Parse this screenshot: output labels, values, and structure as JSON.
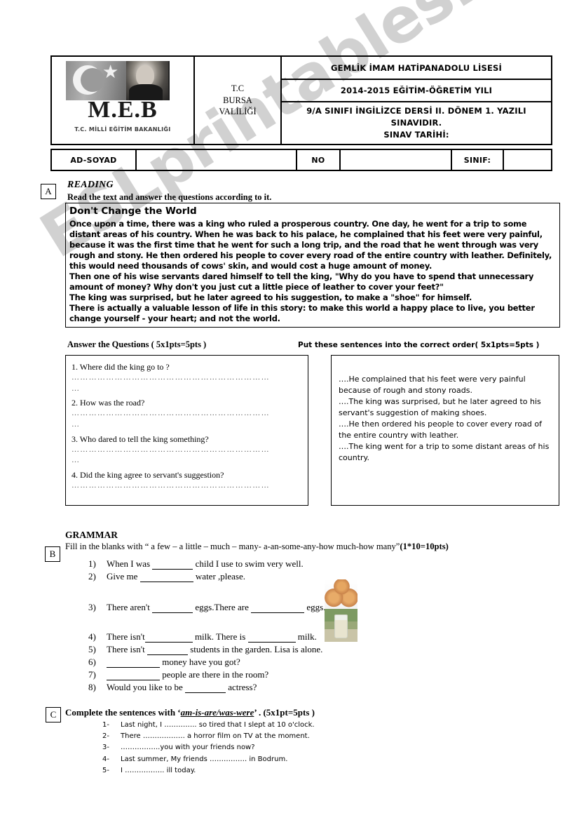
{
  "header": {
    "logo": {
      "meb_text": "M.E.B",
      "meb_subtitle": "T.C. MİLLİ EĞİTİM BAKANLIĞI"
    },
    "tc_cell": "T.C\nBURSA\nVALİLİĞİ",
    "tc_line1": "T.C",
    "tc_line2": "BURSA",
    "tc_line3": "VALİLİĞİ",
    "school": "GEMLİK İMAM HATİPANADOLU LİSESİ",
    "year": "2014-2015 EĞİTİM-ÖĞRETİM YILI",
    "exam_line1": "9/A SINIFI İNGİLİZCE DERSİ II. DÖNEM 1. YAZILI SINAVIDIR.",
    "exam_line2": "SINAV TARİHİ:"
  },
  "student_row": {
    "name_label": "AD-SOYAD",
    "name_value": "",
    "no_label": "NO",
    "no_value": "",
    "class_label": "SINIF:",
    "class_value": ""
  },
  "sections": {
    "a_letter": "A",
    "b_letter": "B",
    "c_letter": "C"
  },
  "reading": {
    "title": "READING",
    "instruction": "Read the text and answer the questions according to it.",
    "passage_title": "Don't Change the World",
    "passage_paragraphs": [
      "Once upon a time, there was a king who ruled a prosperous country. One day, he went for a trip to some distant areas of his country. When he was back to his palace, he complained that his feet were very painful, because it was the first time that he went for such a long trip, and the road that he went through was very rough and stony. He then ordered his people to cover every road of the entire country with leather. Definitely, this would need thousands of cows' skin, and would cost a huge amount of money.",
      "Then one of his wise servants dared himself to tell the king, \"Why do you have to spend that unnecessary amount of money? Why don't you just cut a little piece of leather to cover your feet?\"",
      "The king was surprised, but he later agreed to his suggestion, to make a \"shoe\" for himself.",
      "There is actually a valuable lesson of life in this story: to make this world a happy place to live, you better change yourself - your heart; and not the world."
    ]
  },
  "questions": {
    "heading": "Answer the Questions ( 5x1pts=5pts )",
    "dots_line": "……………………………………………………………",
    "dots_short": "…",
    "items": [
      "1. Where did the king go to ?",
      "2. How was the road?",
      "3. Who dared to tell the king something?",
      "4. Did the king agree to servant's suggestion?"
    ]
  },
  "ordering": {
    "heading": "Put these sentences into the correct order( 5x1pts=5pts )",
    "items": [
      "….He complained that his feet were very painful because of rough and stony roads.",
      "….The king was surprised, but he later agreed to his servant's suggestion of making shoes.",
      "….He then ordered his people to cover every road of the entire country with leather.",
      "….The king went for a trip to some distant areas of his country."
    ]
  },
  "grammar": {
    "title": "GRAMMAR",
    "instruction_plain": "Fill in the blanks with “ a few – a little – much – many- a-an-some-any-how much-how many”",
    "instruction_points": "(1*10=10pts)",
    "items": [
      {
        "num": "1)",
        "pre": "When I was",
        "blank": "b60",
        "post": "child I use to swim very well."
      },
      {
        "num": "2)",
        "pre": "Give me",
        "blank": "b78",
        "post": "water ,please."
      },
      {
        "num": "3)",
        "pre": "There aren't",
        "blank": "b60",
        "mid": "eggs.There are",
        "blank2": "b78",
        "post": "eggs."
      },
      {
        "num": "4)",
        "pre": "There isn't",
        "blank": "b70",
        "mid": "milk. There is",
        "blank2": "b70",
        "post": "milk."
      },
      {
        "num": "5)",
        "pre": "There isn't",
        "blank": "b60",
        "post": "students in the garden. Lisa is alone."
      },
      {
        "num": "6)",
        "pre": "",
        "blank": "b78",
        "post": "money have you got?"
      },
      {
        "num": "7)",
        "pre": "",
        "blank": "b78",
        "post": "people are there in the room?"
      },
      {
        "num": "8)",
        "pre": "Would you like to be",
        "blank": "b60",
        "post": "actress?"
      }
    ],
    "images": {
      "eggs": "eggs-photo",
      "milk": "milk-glass-photo"
    }
  },
  "complete": {
    "instruction_pre": "Complete the sentences with  ‘",
    "instruction_em": "am-is-are/was-were",
    "instruction_post": "’ .  (5x1pt=5pts )",
    "items": [
      {
        "num": "1-",
        "text": "Last night, I ………….. so tired that I slept at 10 o'clock."
      },
      {
        "num": "2-",
        "text": "There ……………… a horror film on TV at the moment."
      },
      {
        "num": "3-",
        "text": "……………..you with your friends now?"
      },
      {
        "num": "4-",
        "text": "Last summer, My friends ……………. in Bodrum."
      },
      {
        "num": "5-",
        "text": "I …………….. ill  today."
      }
    ]
  },
  "watermark": {
    "text": "ESLprintables.com",
    "color": "#c9c9c9"
  }
}
